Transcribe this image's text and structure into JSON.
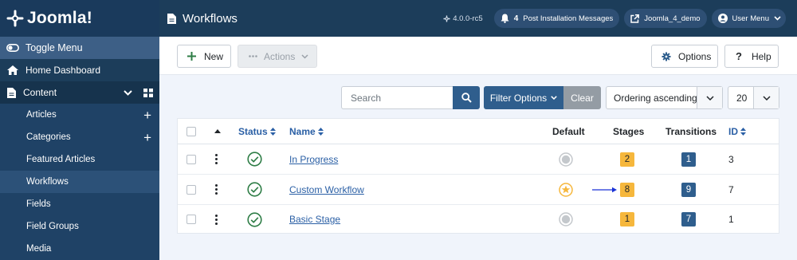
{
  "brand": {
    "name": "Joomla!"
  },
  "sidebar": {
    "toggle_label": "Toggle Menu",
    "home_label": "Home Dashboard",
    "content_label": "Content",
    "items": [
      {
        "label": "Articles",
        "has_add": true
      },
      {
        "label": "Categories",
        "has_add": true
      },
      {
        "label": "Featured Articles",
        "has_add": false
      },
      {
        "label": "Workflows",
        "has_add": false,
        "active": true
      },
      {
        "label": "Fields",
        "has_add": false
      },
      {
        "label": "Field Groups",
        "has_add": false
      },
      {
        "label": "Media",
        "has_add": false
      }
    ]
  },
  "header": {
    "title": "Workflows",
    "version": "4.0.0-rc5",
    "notifications_count": "4",
    "notifications_label": "Post Installation Messages",
    "site_label": "Joomla_4_demo",
    "user_label": "User Menu"
  },
  "toolbar": {
    "new_label": "New",
    "actions_label": "Actions",
    "options_label": "Options",
    "help_label": "Help"
  },
  "filters": {
    "search_placeholder": "Search",
    "filter_options_label": "Filter Options",
    "clear_label": "Clear",
    "ordering_value": "Ordering ascending",
    "limit_value": "20"
  },
  "table": {
    "columns": {
      "status": "Status",
      "name": "Name",
      "default": "Default",
      "stages": "Stages",
      "transitions": "Transitions",
      "id": "ID"
    },
    "rows": [
      {
        "name": "In Progress",
        "default": false,
        "stages": "2",
        "transitions": "1",
        "id": "3"
      },
      {
        "name": "Custom Workflow",
        "default": true,
        "stages": "8",
        "transitions": "9",
        "id": "7"
      },
      {
        "name": "Basic Stage",
        "default": false,
        "stages": "1",
        "transitions": "7",
        "id": "1"
      }
    ]
  },
  "colors": {
    "header_bg": "#1c3d5a",
    "accent_blue": "#2f5e8d",
    "stage_badge": "#f6b73c",
    "published_green": "#2e7d46",
    "default_star": "#f6b73c"
  }
}
